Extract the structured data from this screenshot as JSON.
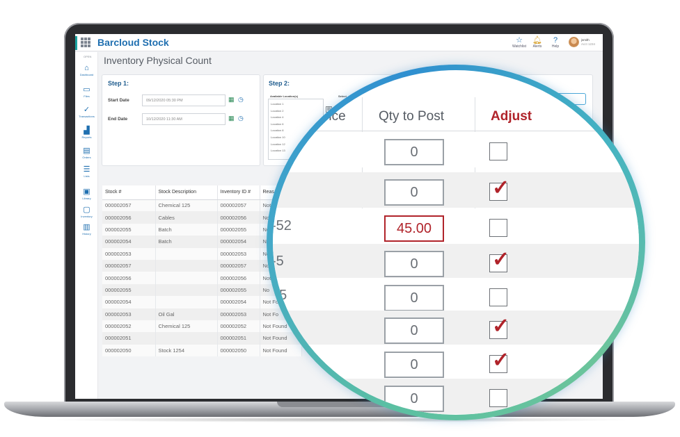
{
  "app": {
    "title": "Barcloud Stock",
    "header_tools": [
      {
        "label": "Watchlist",
        "icon": "star-icon"
      },
      {
        "label": "Alerts",
        "icon": "bell-icon"
      },
      {
        "label": "Help",
        "icon": "question-icon"
      }
    ],
    "user": {
      "name": "jsmith",
      "sub": "Acct 1234"
    }
  },
  "sidebar": {
    "top_label": "OPEN",
    "items": [
      {
        "label": "Dashboard",
        "icon": "home-icon"
      },
      {
        "label": "Files",
        "icon": "folder-icon"
      },
      {
        "label": "Transactions",
        "icon": "check-circle-icon"
      },
      {
        "label": "Reports",
        "icon": "bar-chart-icon"
      },
      {
        "label": "Orders",
        "icon": "document-icon"
      },
      {
        "label": "Lists",
        "icon": "list-icon"
      },
      {
        "label": "Library",
        "icon": "image-icon"
      },
      {
        "label": "Inventory",
        "icon": "box-icon"
      },
      {
        "label": "History",
        "icon": "book-icon"
      }
    ]
  },
  "page": {
    "title": "Inventory Physical Count",
    "step1": {
      "label": "Step 1:",
      "start_label": "Start Date",
      "start_value": "09/12/2020 05:30 PM",
      "end_label": "End Date",
      "end_value": "10/12/2020 11:30 AM"
    },
    "step2": {
      "label": "Step 2:",
      "locations_label": "Available Location(s)",
      "select_label": "Select",
      "locations": [
        "Location 1",
        "Location 2",
        "Location 4",
        "Location 6",
        "Location 8",
        "Location 10",
        "Location 12",
        "Location 13",
        "Location 14"
      ]
    }
  },
  "table": {
    "headers": [
      "Stock #",
      "Stock Description",
      "Inventory ID #",
      "Reas"
    ],
    "rows": [
      [
        "000002057",
        "Chemical 125",
        "000002057",
        "Not"
      ],
      [
        "000002056",
        "Cables",
        "000002056",
        "No"
      ],
      [
        "000002055",
        "Batch",
        "000002055",
        "No"
      ],
      [
        "000002054",
        "Batch",
        "000002054",
        "No"
      ],
      [
        "000002053",
        "",
        "000002053",
        "No"
      ],
      [
        "000002057",
        "",
        "000002057",
        "No"
      ],
      [
        "000002056",
        "",
        "000002056",
        "Not"
      ],
      [
        "000002055",
        "",
        "000002055",
        "No"
      ],
      [
        "000002054",
        "",
        "000002054",
        "Not Fo"
      ],
      [
        "000002053",
        "Oil Gal",
        "000002053",
        "Not Fo"
      ],
      [
        "000002052",
        "Chemical 125",
        "000002052",
        "Not Found"
      ],
      [
        "000002051",
        "",
        "000002051",
        "Not Found"
      ],
      [
        "000002050",
        "Stock 1254",
        "000002050",
        "Not Found"
      ]
    ]
  },
  "magnifier": {
    "headers": {
      "variance_partial": "nce",
      "qty": "Qty to Post",
      "adjust": "Adjust"
    },
    "rows": [
      {
        "variance": "",
        "qty": "0",
        "adjust": false,
        "highlight": false
      },
      {
        "variance": "",
        "qty": "0",
        "adjust": true,
        "highlight": false
      },
      {
        "variance": "-52",
        "qty": "45.00",
        "adjust": false,
        "highlight": true
      },
      {
        "variance": "-5",
        "qty": "0",
        "adjust": true,
        "highlight": false
      },
      {
        "variance": "25",
        "qty": "0",
        "adjust": false,
        "highlight": false
      },
      {
        "variance": "",
        "qty": "0",
        "adjust": true,
        "highlight": false
      },
      {
        "variance": "",
        "qty": "0",
        "adjust": true,
        "highlight": false
      },
      {
        "variance": "",
        "qty": "0",
        "adjust": false,
        "highlight": false
      }
    ],
    "colors": {
      "adjust": "#b0232a",
      "ring_start": "#5bc0a2",
      "ring_end": "#2f8fd0"
    }
  }
}
